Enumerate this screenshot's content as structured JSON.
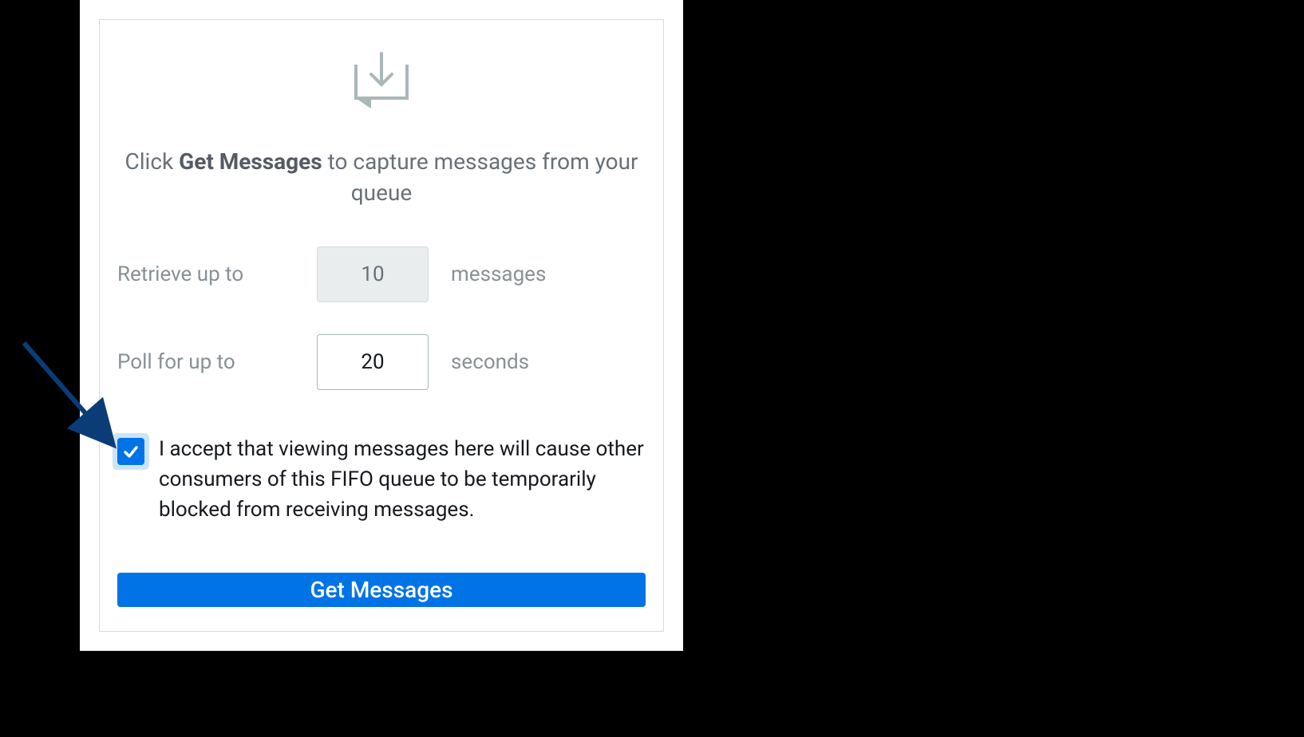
{
  "instruction": {
    "pre": "Click ",
    "bold": "Get Messages",
    "post": " to capture messages from your queue"
  },
  "retrieve": {
    "label_left": "Retrieve up to",
    "value": "10",
    "label_right": "messages"
  },
  "poll": {
    "label_left": "Poll for up to",
    "value": "20",
    "label_right": "seconds"
  },
  "accept": {
    "checked": true,
    "text": "I accept that viewing messages here will cause other consumers of this FIFO queue to be temporarily blocked from receiving messages."
  },
  "button": {
    "label": "Get Messages"
  }
}
